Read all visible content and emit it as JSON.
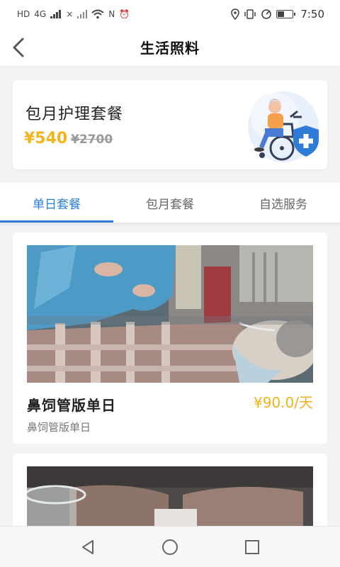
{
  "status_bar": {
    "left_indicators": [
      "HD",
      "4G",
      "×",
      "N",
      "⏰"
    ],
    "time": "7:50"
  },
  "header": {
    "title": "生活照料",
    "back_icon": "chevron-left-icon"
  },
  "package": {
    "title": "包月护理套餐",
    "price": "¥540",
    "original_price": "¥2700"
  },
  "tabs": [
    {
      "label": "单日套餐",
      "active": true
    },
    {
      "label": "包月套餐",
      "active": false
    },
    {
      "label": "自选服务",
      "active": false
    }
  ],
  "services": [
    {
      "name": "鼻饲管版单日",
      "subtitle": "鼻饲管版单日",
      "price": "¥90.0/天"
    }
  ],
  "nav": {
    "back_icon": "triangle-back-icon",
    "home_icon": "circle-home-icon",
    "recent_icon": "square-recents-icon"
  },
  "colors": {
    "accent": "#2a7ed8",
    "price": "#f3b41b"
  }
}
